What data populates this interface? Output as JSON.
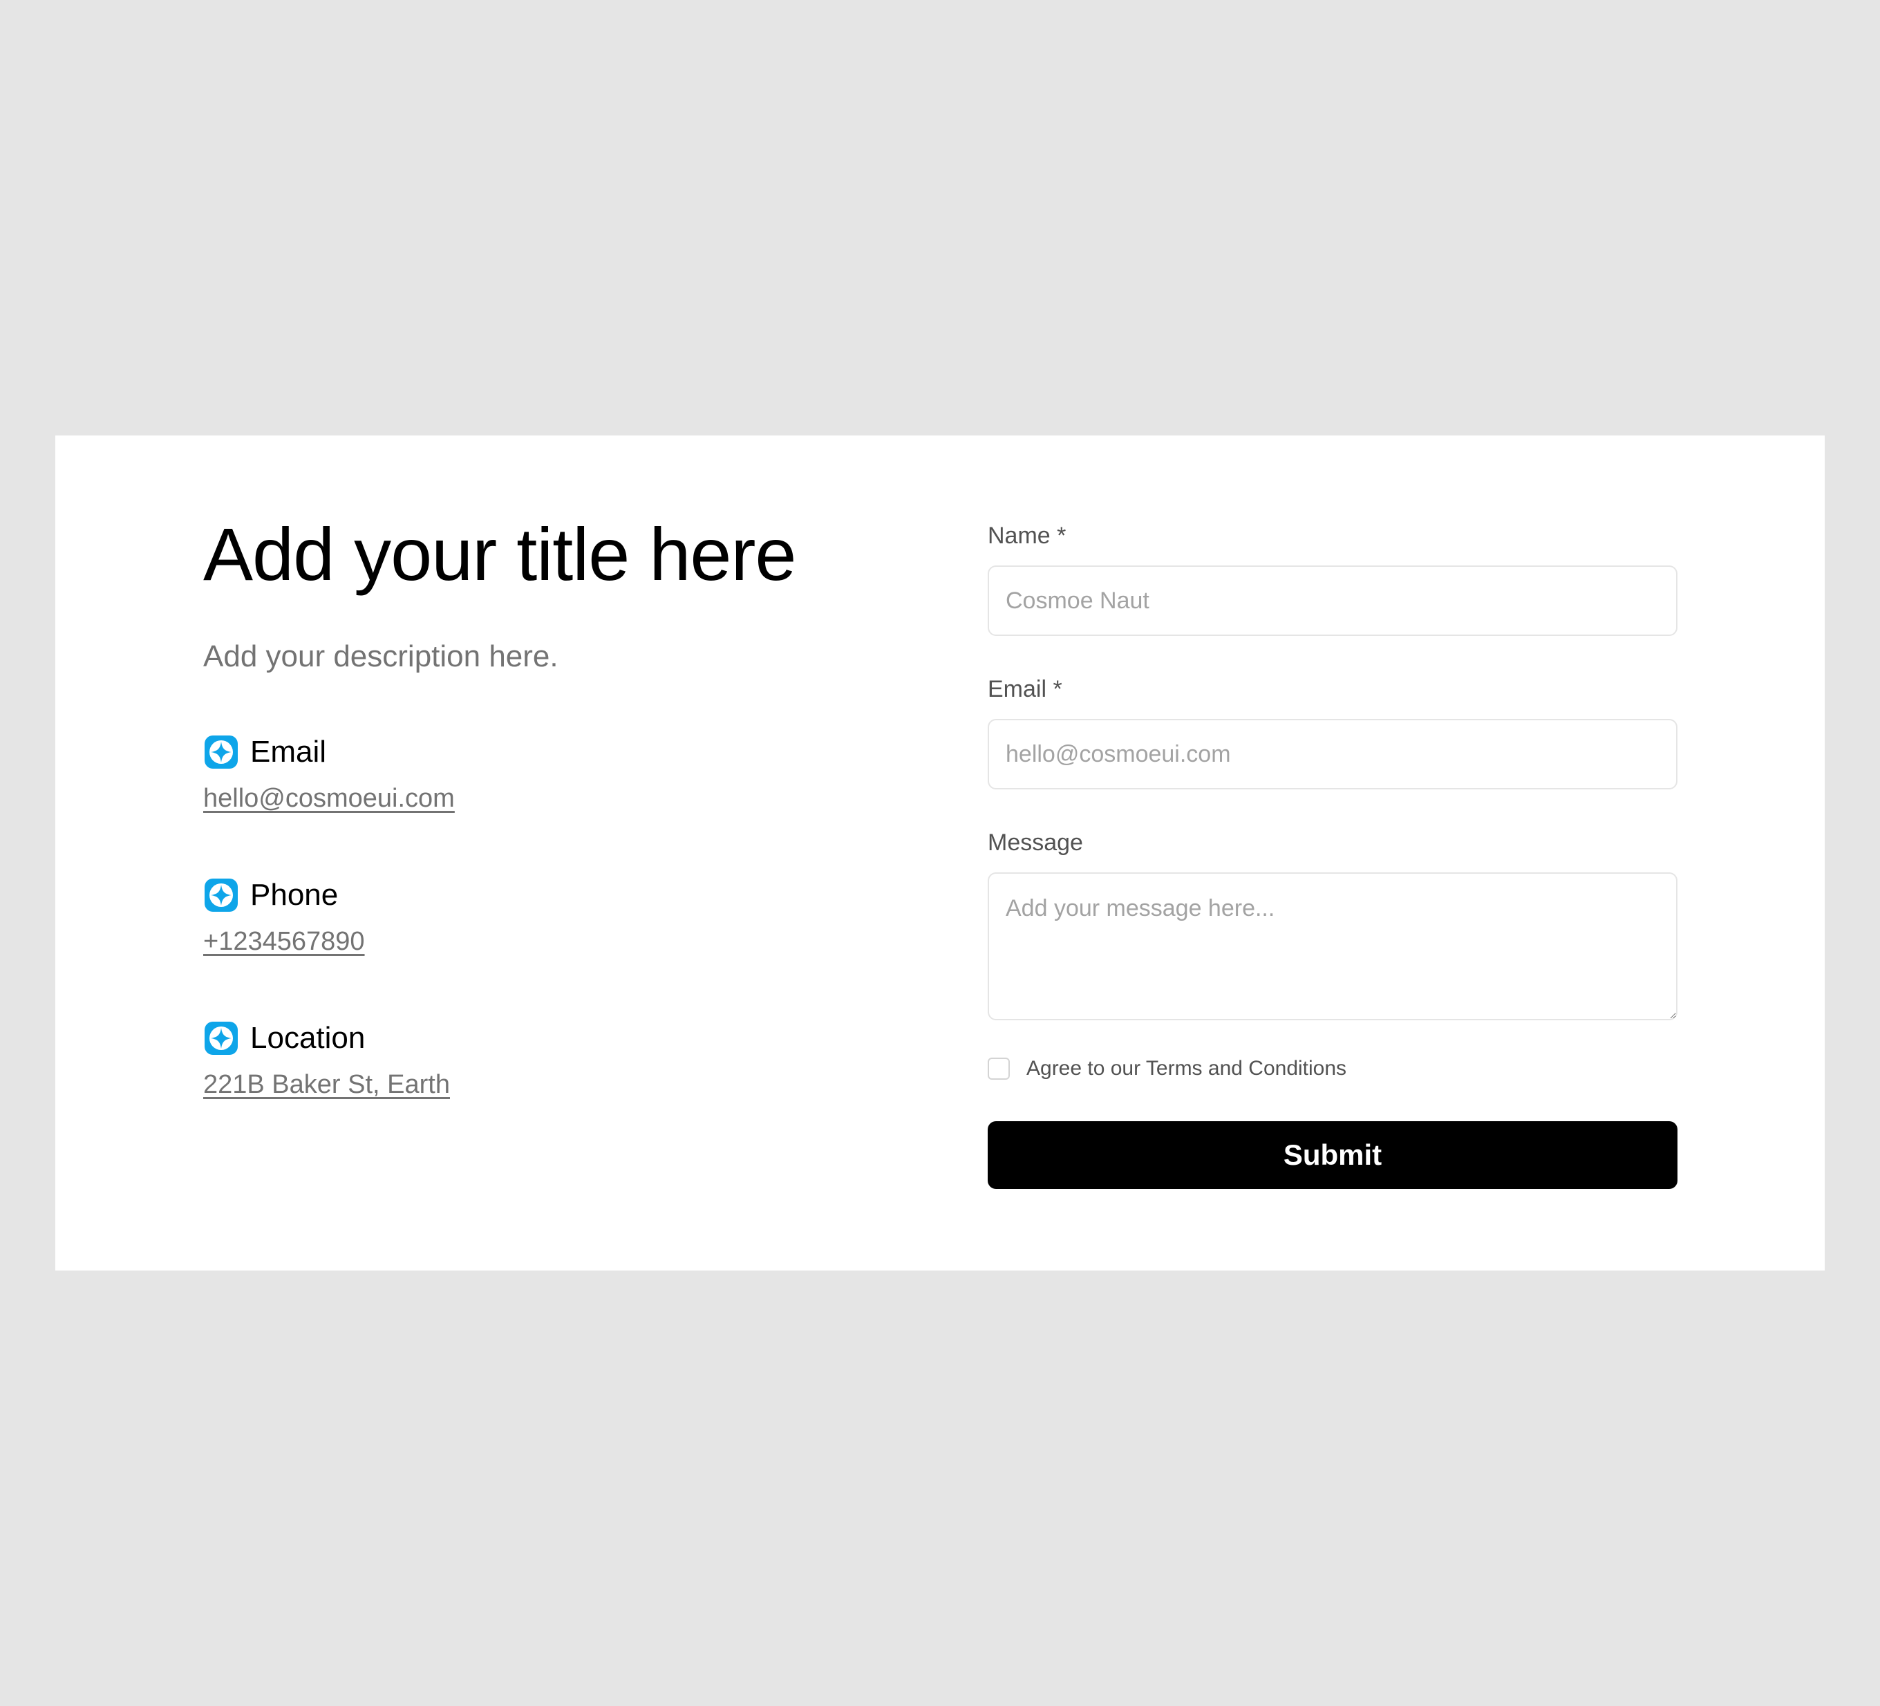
{
  "colors": {
    "page_background": "#e5e5e5",
    "card_background": "#ffffff",
    "accent_icon": "#0ea5e9",
    "button_background": "#000000",
    "button_text": "#ffffff",
    "muted_text": "#737373"
  },
  "contact_info": {
    "title": "Add your title here",
    "description": "Add your description here.",
    "items": [
      {
        "icon": "sparkle-icon",
        "label": "Email",
        "value": "hello@cosmoeui.com"
      },
      {
        "icon": "sparkle-icon",
        "label": "Phone",
        "value": "+1234567890"
      },
      {
        "icon": "sparkle-icon",
        "label": "Location",
        "value": "221B Baker St, Earth"
      }
    ]
  },
  "form": {
    "name": {
      "label": "Name *",
      "placeholder": "Cosmoe Naut",
      "value": ""
    },
    "email": {
      "label": "Email *",
      "placeholder": "hello@cosmoeui.com",
      "value": ""
    },
    "message": {
      "label": "Message",
      "placeholder": "Add your message here...",
      "value": ""
    },
    "terms": {
      "label": "Agree to our Terms and Conditions",
      "checked": false
    },
    "submit_label": "Submit"
  }
}
